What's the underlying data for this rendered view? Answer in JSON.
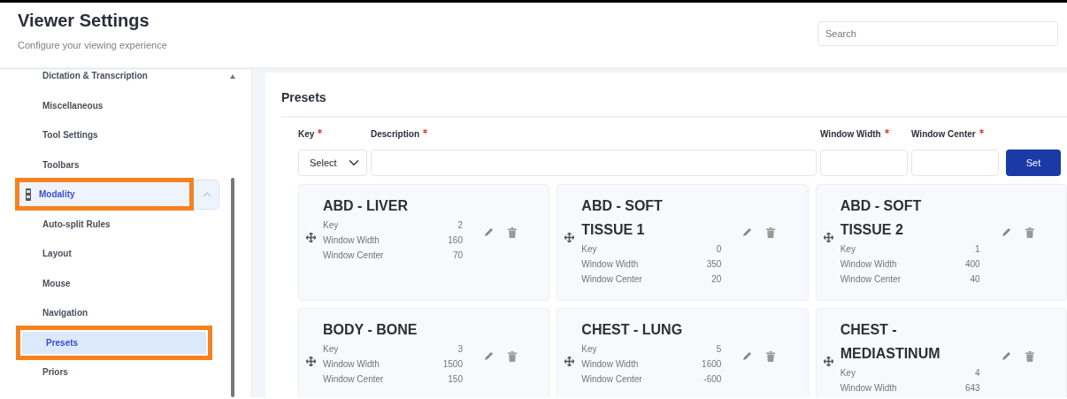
{
  "header": {
    "title": "Viewer Settings",
    "subtitle": "Configure your viewing experience",
    "search": {
      "placeholder": "Search"
    }
  },
  "sidebar": {
    "items": [
      {
        "kind": "item",
        "label": "Dictation & Transcription",
        "selected": false,
        "highlighted": false
      },
      {
        "kind": "item",
        "label": "Miscellaneous",
        "selected": false,
        "highlighted": false
      },
      {
        "kind": "item",
        "label": "Tool Settings",
        "selected": false,
        "highlighted": false
      },
      {
        "kind": "item",
        "label": "Toolbars",
        "selected": false,
        "highlighted": false
      },
      {
        "kind": "group",
        "label": "Modality",
        "selected": true,
        "highlighted": true,
        "expanded": true
      },
      {
        "kind": "item",
        "label": "Auto-split Rules",
        "selected": false,
        "highlighted": false
      },
      {
        "kind": "item",
        "label": "Layout",
        "selected": false,
        "highlighted": false
      },
      {
        "kind": "item",
        "label": "Mouse",
        "selected": false,
        "highlighted": false
      },
      {
        "kind": "item",
        "label": "Navigation",
        "selected": false,
        "highlighted": false
      },
      {
        "kind": "item",
        "label": "Presets",
        "selected": true,
        "highlighted": true
      },
      {
        "kind": "item",
        "label": "Priors",
        "selected": false,
        "highlighted": false
      }
    ]
  },
  "presets": {
    "title": "Presets",
    "form": {
      "fields": [
        {
          "kind": "select",
          "label": "Key",
          "required": true,
          "value": "Select"
        },
        {
          "kind": "text",
          "label": "Description",
          "required": true
        },
        {
          "kind": "text",
          "label": "Window Width",
          "required": true
        },
        {
          "kind": "text",
          "label": "Window Center",
          "required": true
        }
      ],
      "button": "Set"
    },
    "cards": [
      {
        "title": "ABD - LIVER",
        "fields": [
          {
            "label": "Key",
            "value": "2"
          },
          {
            "label": "Window Width",
            "value": "160"
          },
          {
            "label": "Window Center",
            "value": "70"
          }
        ]
      },
      {
        "title": "ABD - SOFT TISSUE 1",
        "fields": [
          {
            "label": "Key",
            "value": "0"
          },
          {
            "label": "Window Width",
            "value": "350"
          },
          {
            "label": "Window Center",
            "value": "20"
          }
        ]
      },
      {
        "title": "ABD - SOFT TISSUE 2",
        "fields": [
          {
            "label": "Key",
            "value": "1"
          },
          {
            "label": "Window Width",
            "value": "400"
          },
          {
            "label": "Window Center",
            "value": "40"
          }
        ]
      },
      {
        "title": "BODY - BONE",
        "fields": [
          {
            "label": "Key",
            "value": "3"
          },
          {
            "label": "Window Width",
            "value": "1500"
          },
          {
            "label": "Window Center",
            "value": "150"
          }
        ]
      },
      {
        "title": "CHEST - LUNG",
        "fields": [
          {
            "label": "Key",
            "value": "5"
          },
          {
            "label": "Window Width",
            "value": "1600"
          },
          {
            "label": "Window Center",
            "value": "-600"
          }
        ]
      },
      {
        "title": "CHEST - MEDIASTINUM",
        "fields": [
          {
            "label": "Key",
            "value": "4"
          },
          {
            "label": "Window Width",
            "value": "643"
          }
        ]
      }
    ]
  }
}
